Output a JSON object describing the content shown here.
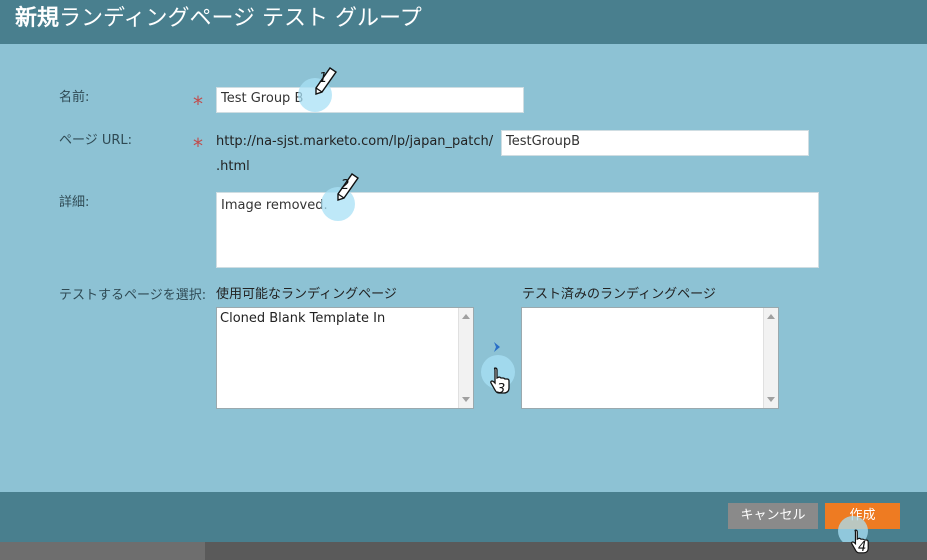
{
  "dialog": {
    "title_bold": "新規",
    "title_rest": "ランディングページ テスト グループ"
  },
  "form": {
    "name_label": "名前:",
    "name_value": "Test Group B",
    "url_label": "ページ URL:",
    "url_prefix": "http://na-sjst.marketo.com/lp/japan_patch/",
    "url_slug": "TestGroupB",
    "url_suffix": ".html",
    "detail_label": "詳細:",
    "detail_value": "Image removed.",
    "select_label": "テストするページを選択:"
  },
  "lists": {
    "available_title": "使用可能なランディングページ",
    "available_items": [
      "Cloned Blank Template In"
    ],
    "tested_title": "テスト済みのランディングページ",
    "tested_items": []
  },
  "buttons": {
    "cancel": "キャンセル",
    "create": "作成"
  },
  "callouts": {
    "c1": "1",
    "c2": "2",
    "c3": "3",
    "c4": "4"
  },
  "icons": {
    "required": "asterisk-icon",
    "move_right": "chevron-right-icon",
    "pencil": "pencil-icon",
    "pointer": "hand-pointer-icon"
  },
  "colors": {
    "header": "#497f8e",
    "body": "#8dc2d4",
    "create_button": "#ee7b22",
    "cancel_button": "#8a8a8a",
    "required": "#c14b4b"
  }
}
